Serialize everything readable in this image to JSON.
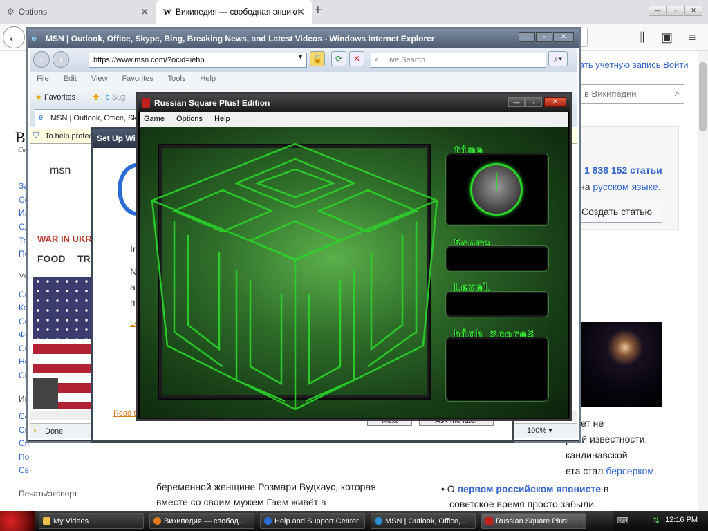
{
  "firefox": {
    "tab1_label": "Options",
    "tab2_label": "Википедия — свободная энцикл",
    "new_tab": "+"
  },
  "wiki": {
    "top_links": "ать учётную запись  Войти",
    "search_placeholder": "в Википедии",
    "logo_fragment": "B",
    "logo_sub": "Св",
    "side_links": [
      "За",
      "Со",
      "Из",
      "Сл",
      "Те",
      "По"
    ],
    "side_heading_1": "Уч",
    "side_links_2": [
      "Со",
      "Ка",
      "Со",
      "Фо",
      "Св",
      "Но",
      "Сп"
    ],
    "side_heading_2": "Ин",
    "side_links_3": [
      "Со",
      "Св",
      "Сп",
      "По",
      "Св"
    ],
    "print_export": "Печать/экспорт",
    "article_count": "1 838 152 статьи",
    "lang_prefix": "на ",
    "lang_link": "русском языке.",
    "create_article": "Создать статью",
    "frag_not": "ет не",
    "frag_fame": "рной известности.",
    "frag_scand": "кандинавской",
    "frag_berserk_prefix": "ета стал ",
    "frag_berserk_link": "берсерком.",
    "bottom_para": "беременной женщине Розмари Вудхаус, которая вместе со своим мужем Гаем живёт в",
    "bottom_right_prefix": "О ",
    "bottom_right_link": "первом российском японисте",
    "bottom_right_suffix": " в",
    "bottom_right_line2": "советское время просто забыли."
  },
  "ie": {
    "title": "MSN | Outlook, Office, Skype, Bing, Breaking News, and Latest Videos - Windows Internet Explorer",
    "address": "https://www.msn.com/?ocid=iehp",
    "search_placeholder": "Live Search",
    "menu": [
      "File",
      "Edit",
      "View",
      "Favorites",
      "Tools",
      "Help"
    ],
    "favorites_label": "Favorites",
    "suggested": "Sug",
    "tab_label": "MSN | Outlook, Office, Sky",
    "infobar": "To help protec",
    "status": "Done",
    "zoom": "100%"
  },
  "msn": {
    "logo": "msn",
    "war": "WAR IN UKRA",
    "food": "FOOD",
    "tra": "TRA"
  },
  "setup": {
    "title": "Set Up Wi",
    "close": "×",
    "line_in": "In",
    "line_n": "N",
    "line_a": "ar",
    "line_m": "m",
    "learn": "Le",
    "read": "Read t",
    "next": "Next",
    "ask_later": "Ask me later"
  },
  "game": {
    "title": "Russian Square Plus! Edition",
    "menu": [
      "Game",
      "Options",
      "Help"
    ],
    "label_time": "time",
    "label_score": "Score",
    "label_level": "Level",
    "label_high": "high ScoreS"
  },
  "taskbar": {
    "items": [
      "My Videos",
      "Википедия — свобод...",
      "Help and Support Center",
      "MSN | Outlook, Office,...",
      "Russian Square Plus! ..."
    ],
    "clock": "12:16 PM"
  },
  "colors": {
    "accent_green": "#36ff36",
    "wiki_link": "#3366cc"
  }
}
